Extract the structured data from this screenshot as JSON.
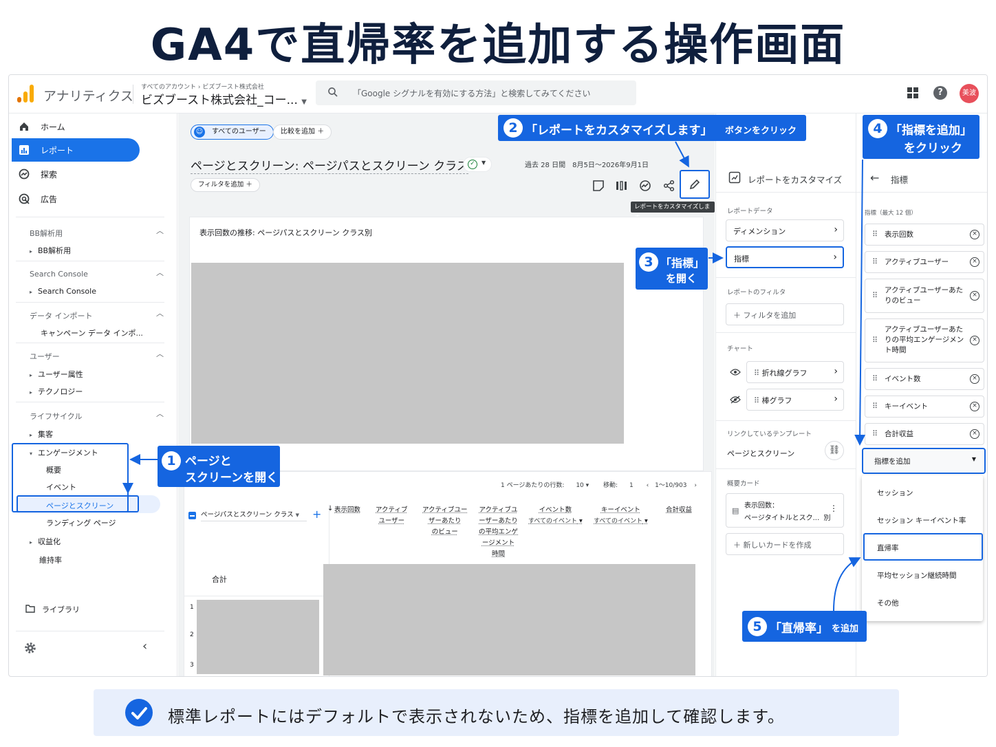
{
  "headline": "GA4で直帰率を追加する操作画面",
  "app": {
    "name": "アナリティクス",
    "account_crumb": "すべてのアカウント › ビズブースト株式会社",
    "account_name": "ビズブースト株式会社_コー...",
    "search_placeholder": "「Google シグナルを有効にする方法」と検索してみてください",
    "avatar_label": "美波"
  },
  "sidebar": {
    "nav": [
      {
        "label": "ホーム"
      },
      {
        "label": "レポート"
      },
      {
        "label": "探索"
      },
      {
        "label": "広告"
      }
    ],
    "sections": {
      "bb": {
        "title": "BB解析用",
        "items": [
          "BB解析用"
        ]
      },
      "sc": {
        "title": "Search Console",
        "items": [
          "Search Console"
        ]
      },
      "di": {
        "title": "データ インポート",
        "items": [
          "キャンペーン データ インポ..."
        ]
      },
      "user": {
        "title": "ユーザー",
        "items": [
          "ユーザー属性",
          "テクノロジー"
        ]
      },
      "life": {
        "title": "ライフサイクル",
        "acquisition": "集客",
        "engagement": "エンゲージメント",
        "engagement_items": [
          "概要",
          "イベント",
          "ページとスクリーン",
          "ランディング ページ"
        ],
        "monetization": "収益化",
        "retention": "維持率"
      }
    },
    "library": "ライブラリ"
  },
  "main": {
    "all_users_chip": "すべてのユーザー",
    "compare_chip": "比較を追加",
    "page_title": "ページとスクリーン: ページパスとスクリーン クラス",
    "add_filter": "フィルタを追加",
    "date_label": "過去 28 日間",
    "date_range": "8月5日〜2026年9月1日",
    "tooltip": "レポートをカスタマイズします",
    "chart_title": "表示回数の推移: ページパスとスクリーン クラス別",
    "rows_per_page_label": "1 ページあたりの行数:",
    "rows_per_page": "10",
    "goto_label": "移動:",
    "goto_value": "1",
    "pagination": "1〜10/903",
    "dimension_select": "ページパスとスクリーン クラス",
    "columns": [
      "表示回数",
      "アクティブ\nユーザー",
      "アクティブユー\nザーあたり\nのビュー",
      "アクティブユ\nーザーあたり\nの平均エンゲ\nージメント\n時間",
      "イベント数",
      "キーイベント",
      "合計収益"
    ],
    "column_sub": [
      "すべてのイベント",
      "すべてのイベント"
    ],
    "total_label": "合計",
    "row_numbers": [
      "1",
      "2",
      "3"
    ]
  },
  "customize": {
    "title": "レポートをカスタマイズ",
    "report_data_label": "レポートデータ",
    "dimension": "ディメンション",
    "metrics": "指標",
    "filter_label": "レポートのフィルタ",
    "add_filter": "フィルタを追加",
    "chart_label": "チャート",
    "line_chart": "折れ線グラフ",
    "bar_chart": "棒グラフ",
    "linked_template_label": "リンクしているテンプレート",
    "linked_template": "ページとスクリーン",
    "summary_card_label": "概要カード",
    "summary_card_line1": "表示回数：",
    "summary_card_line2": "ページタイトルとスク...  別",
    "new_card": "新しいカードを作成"
  },
  "metrics_panel": {
    "title": "指標",
    "max_label": "指標（最大 12 個）",
    "items": [
      "表示回数",
      "アクティブユーザー",
      "アクティブユーザーあたりのビュー",
      "アクティブユーザーあたりの平均エンゲージメント時間",
      "イベント数",
      "キーイベント",
      "合計収益"
    ],
    "add_metric": "指標を追加",
    "dropdown": [
      "セッション",
      "セッション キーイベント率",
      "直帰率",
      "平均セッション継続時間",
      "その他"
    ]
  },
  "callouts": {
    "c1": {
      "num": "1",
      "line1": "ページと",
      "line2": "スクリーンを開く"
    },
    "c2": {
      "num": "2",
      "main": "「レポートをカスタマイズします」",
      "sub": "ボタンをクリック"
    },
    "c3": {
      "num": "3",
      "line1": "「指標」",
      "line2": "を開く"
    },
    "c4": {
      "num": "4",
      "line1": "「指標を追加」",
      "line2": "をクリック"
    },
    "c5": {
      "num": "5",
      "main": "「直帰率」",
      "sub": "を追加"
    }
  },
  "footer": "標準レポートにはデフォルトで表示されないため、指標を追加して確認します。",
  "colors": {
    "accent": "#1565e0",
    "ga_blue": "#1a73e8",
    "logo_orange": "#f9ab00",
    "logo_red": "#e37400",
    "placeholder_gray": "#c6c6c6"
  }
}
